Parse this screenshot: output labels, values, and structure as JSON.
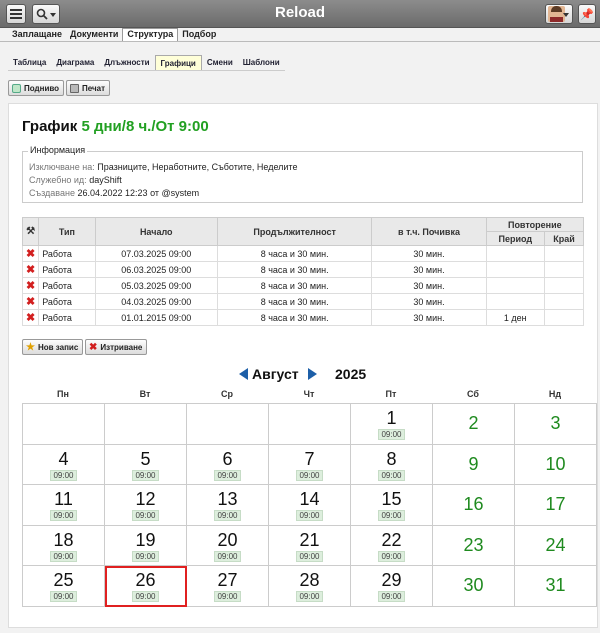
{
  "topbar": {
    "title": "Reload",
    "pin_icon": "pin-icon"
  },
  "main_tabs": [
    "Заплащане",
    "Документи",
    "Структура",
    "Подбор"
  ],
  "sub_tabs": [
    "Таблица",
    "Диаграма",
    "Длъжности",
    "Графици",
    "Смени",
    "Шаблони"
  ],
  "toolbar": {
    "up_label": "Подниво",
    "print_label": "Печат"
  },
  "heading": {
    "prefix": "График",
    "accent": "5 дни/8 ч./От 9:00"
  },
  "info": {
    "title": "Информация",
    "exclude_label": "Изключване на:",
    "exclude_value": "Празниците, Неработните, Съботите, Неделите",
    "id_label": "Служебно ид:",
    "id_value": "dayShift",
    "created_label": "Създаване",
    "created_value": "26.04.2022 12:23 от @system"
  },
  "table": {
    "headers": {
      "type": "Тип",
      "start": "Начало",
      "duration": "Продължителност",
      "break": "в т.ч. Почивка",
      "repeat": "Повторение",
      "period": "Период",
      "end": "Край"
    },
    "rows": [
      {
        "type": "Работа",
        "start": "07.03.2025 09:00",
        "duration": "8 часа и 30 мин.",
        "break": "30 мин.",
        "period": "",
        "end": ""
      },
      {
        "type": "Работа",
        "start": "06.03.2025 09:00",
        "duration": "8 часа и 30 мин.",
        "break": "30 мин.",
        "period": "",
        "end": ""
      },
      {
        "type": "Работа",
        "start": "05.03.2025 09:00",
        "duration": "8 часа и 30 мин.",
        "break": "30 мин.",
        "period": "",
        "end": ""
      },
      {
        "type": "Работа",
        "start": "04.03.2025 09:00",
        "duration": "8 часа и 30 мин.",
        "break": "30 мин.",
        "period": "",
        "end": ""
      },
      {
        "type": "Работа",
        "start": "01.01.2015 09:00",
        "duration": "8 часа и 30 мин.",
        "break": "30 мин.",
        "period": "1 ден",
        "end": ""
      }
    ]
  },
  "actions": {
    "new_label": "Нов запис",
    "delete_label": "Изтриване"
  },
  "calendar": {
    "month": "Август",
    "year": "2025",
    "weekdays": [
      "Пн",
      "Вт",
      "Ср",
      "Чт",
      "Пт",
      "Сб",
      "Нд"
    ],
    "time_label": "09:00",
    "weeks": [
      [
        "",
        "",
        "",
        "",
        "1",
        "2",
        "3"
      ],
      [
        "4",
        "5",
        "6",
        "7",
        "8",
        "9",
        "10"
      ],
      [
        "11",
        "12",
        "13",
        "14",
        "15",
        "16",
        "17"
      ],
      [
        "18",
        "19",
        "20",
        "21",
        "22",
        "23",
        "24"
      ],
      [
        "25",
        "26",
        "27",
        "28",
        "29",
        "30",
        "31"
      ]
    ],
    "today": "26"
  }
}
